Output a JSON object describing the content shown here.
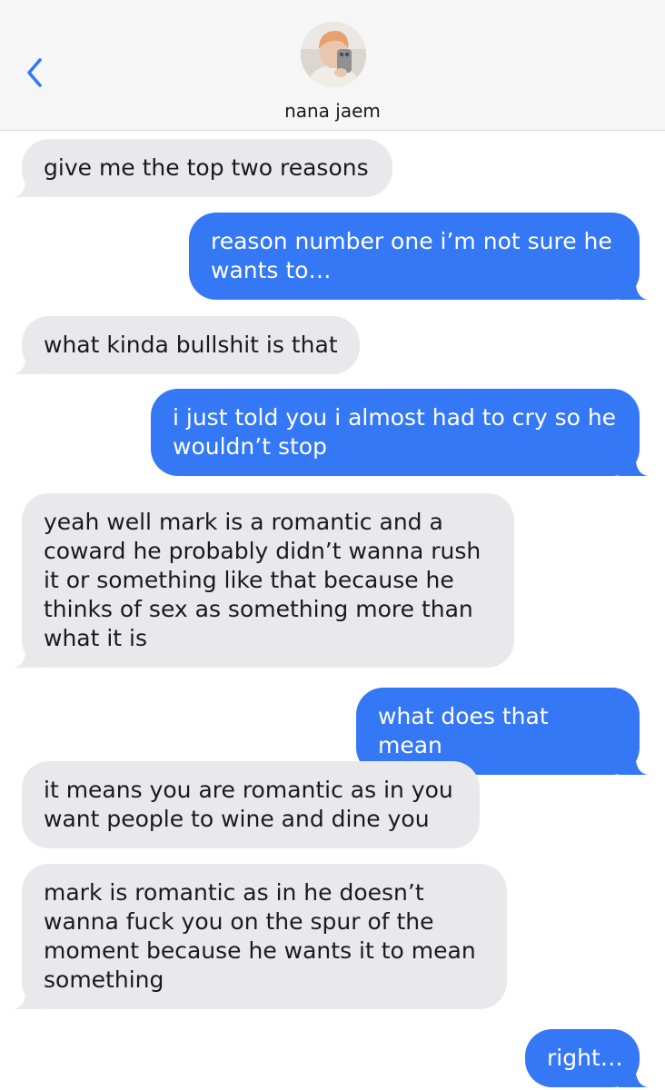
{
  "header": {
    "back_icon": "chevron-left-icon",
    "contact_name": "nana jaem",
    "accent_color": "#3478f6"
  },
  "messages": [
    {
      "direction": "incoming",
      "text": "give me the top two reasons"
    },
    {
      "direction": "outgoing",
      "text": "reason number one i’m not sure he wants to…"
    },
    {
      "direction": "incoming",
      "text": "what kinda bullshit is that"
    },
    {
      "direction": "outgoing",
      "text": "i just told you i almost had to cry so he wouldn’t stop"
    },
    {
      "direction": "incoming",
      "text": "yeah well mark is a romantic and a coward he probably didn’t wanna rush it or something like that because he thinks of sex as something more than what it is"
    },
    {
      "direction": "outgoing",
      "text": "what does that mean"
    },
    {
      "direction": "incoming",
      "text": "it means you are romantic as in you want people to wine and dine you"
    },
    {
      "direction": "incoming",
      "text": "mark is romantic as in he doesn’t wanna fuck you on the spur of the moment because he wants it to mean something"
    },
    {
      "direction": "outgoing",
      "text": "right…"
    }
  ]
}
